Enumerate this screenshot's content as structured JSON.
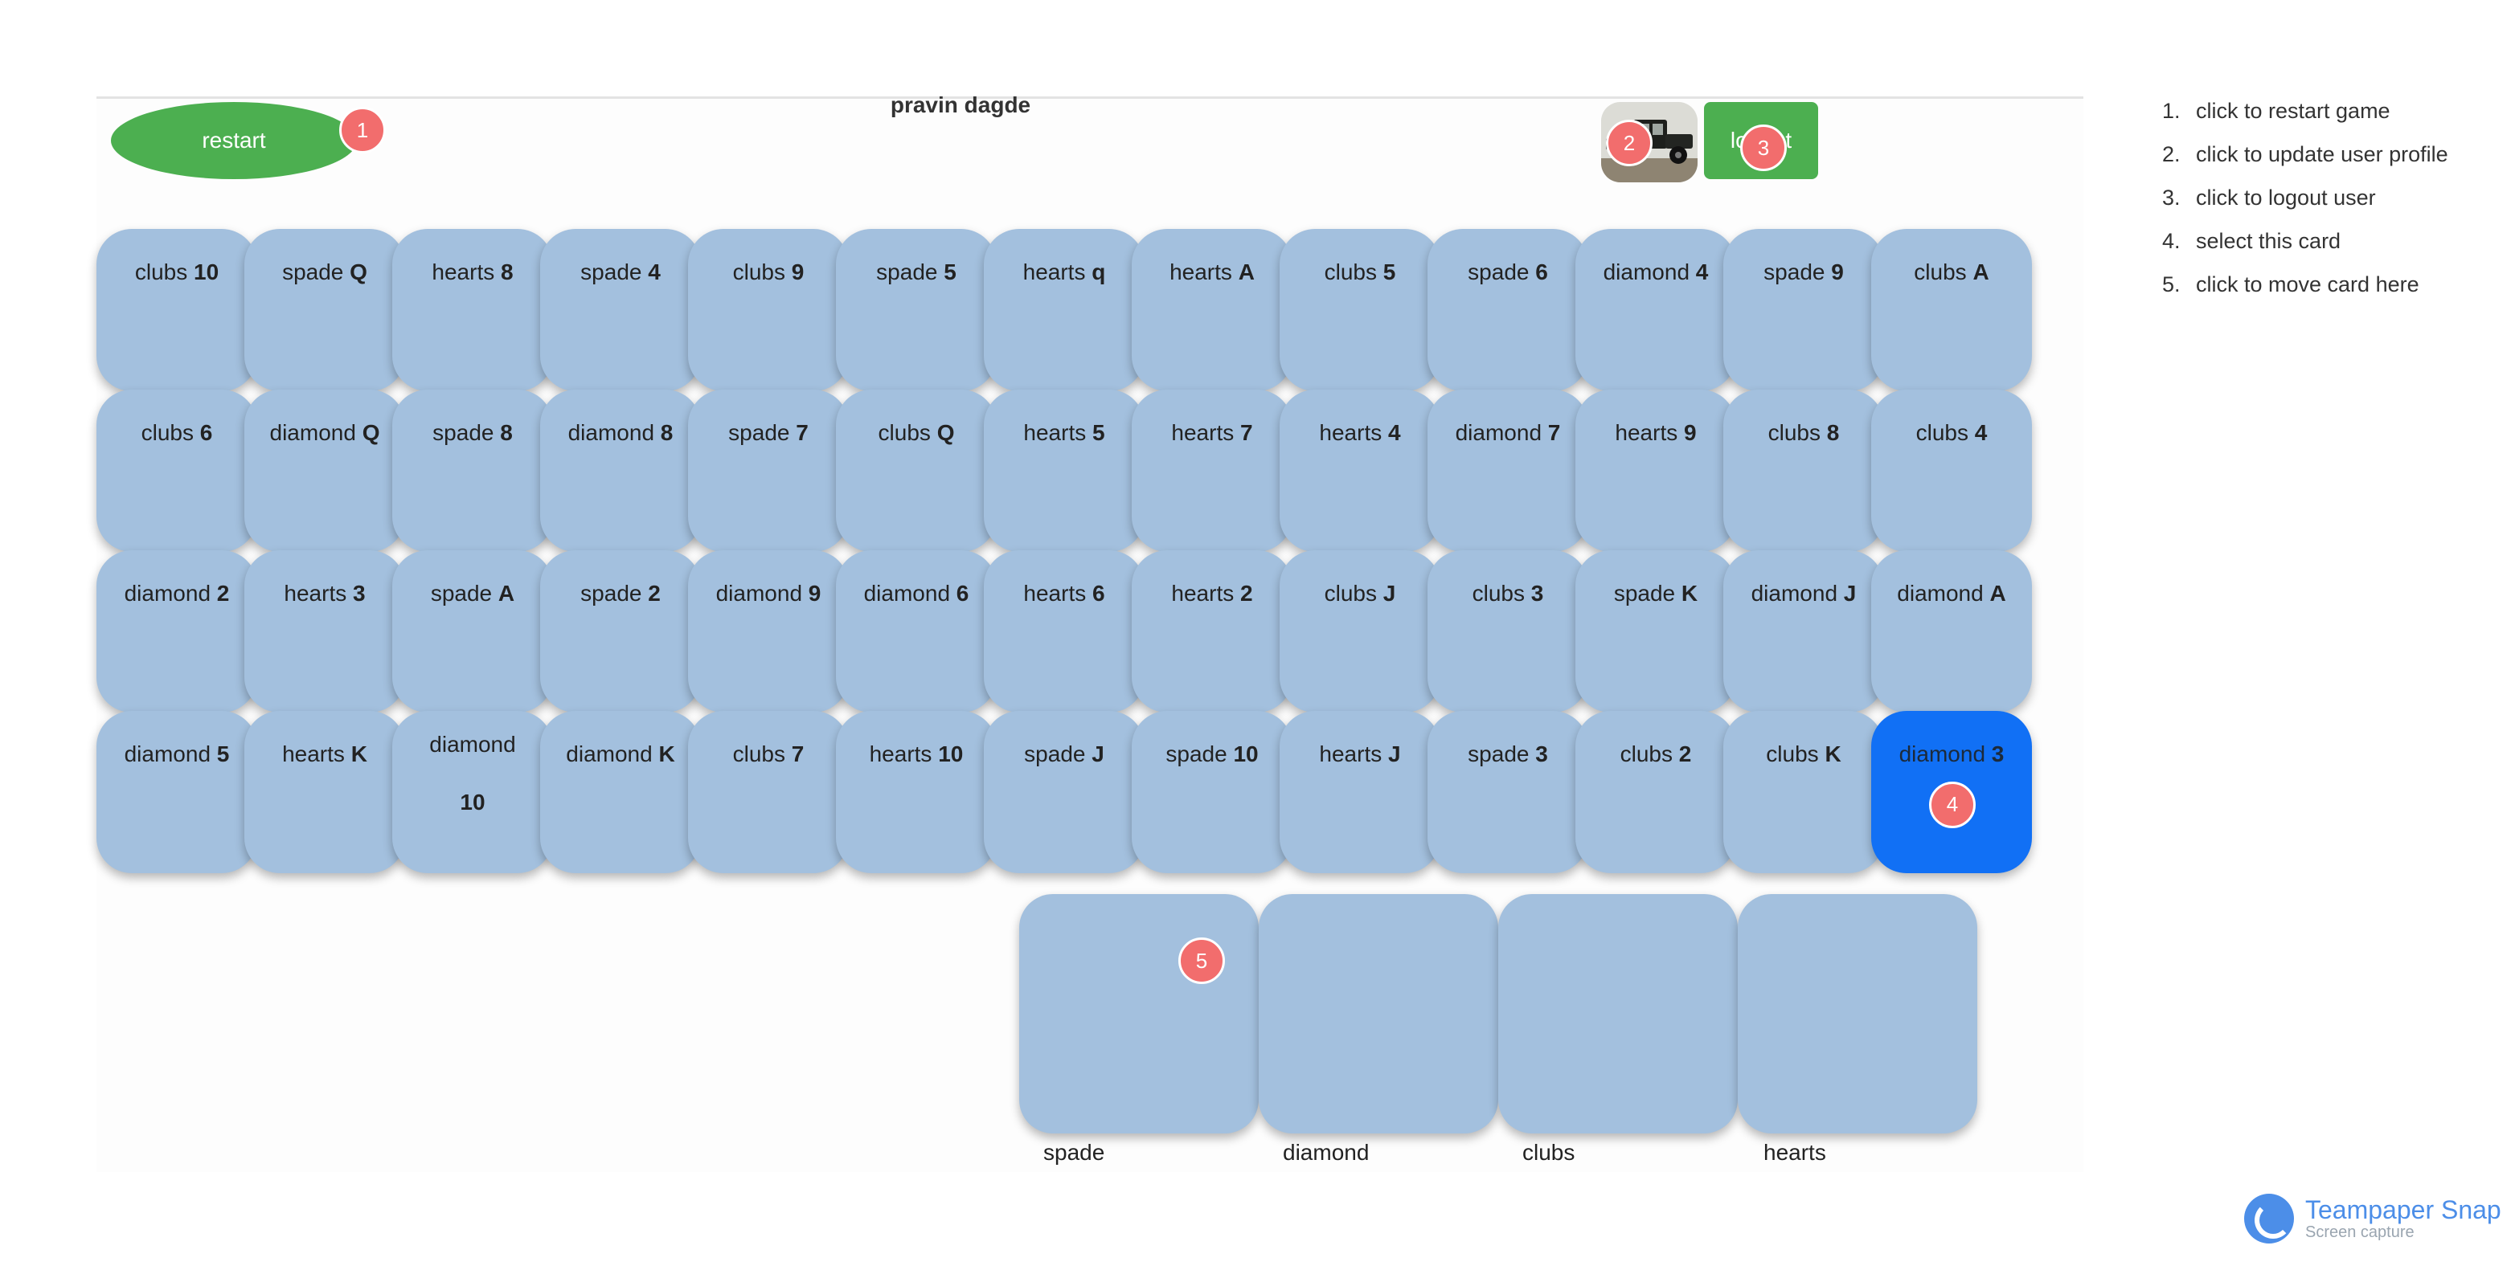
{
  "header": {
    "restart_label": "restart",
    "username": "pravin dagde",
    "logout_label": "logout"
  },
  "badges": [
    "1",
    "2",
    "3",
    "4",
    "5"
  ],
  "board": {
    "rows": [
      [
        {
          "suit": "clubs",
          "rank": "10"
        },
        {
          "suit": "spade",
          "rank": "Q"
        },
        {
          "suit": "hearts",
          "rank": "8"
        },
        {
          "suit": "spade",
          "rank": "4"
        },
        {
          "suit": "clubs",
          "rank": "9"
        },
        {
          "suit": "spade",
          "rank": "5"
        },
        {
          "suit": "hearts",
          "rank": "q"
        },
        {
          "suit": "hearts",
          "rank": "A"
        },
        {
          "suit": "clubs",
          "rank": "5"
        },
        {
          "suit": "spade",
          "rank": "6"
        },
        {
          "suit": "diamond",
          "rank": "4"
        },
        {
          "suit": "spade",
          "rank": "9"
        },
        {
          "suit": "clubs",
          "rank": "A"
        }
      ],
      [
        {
          "suit": "clubs",
          "rank": "6"
        },
        {
          "suit": "diamond",
          "rank": "Q"
        },
        {
          "suit": "spade",
          "rank": "8"
        },
        {
          "suit": "diamond",
          "rank": "8"
        },
        {
          "suit": "spade",
          "rank": "7"
        },
        {
          "suit": "clubs",
          "rank": "Q"
        },
        {
          "suit": "hearts",
          "rank": "5"
        },
        {
          "suit": "hearts",
          "rank": "7"
        },
        {
          "suit": "hearts",
          "rank": "4"
        },
        {
          "suit": "diamond",
          "rank": "7"
        },
        {
          "suit": "hearts",
          "rank": "9"
        },
        {
          "suit": "clubs",
          "rank": "8"
        },
        {
          "suit": "clubs",
          "rank": "4"
        }
      ],
      [
        {
          "suit": "diamond",
          "rank": "2"
        },
        {
          "suit": "hearts",
          "rank": "3"
        },
        {
          "suit": "spade",
          "rank": "A"
        },
        {
          "suit": "spade",
          "rank": "2"
        },
        {
          "suit": "diamond",
          "rank": "9"
        },
        {
          "suit": "diamond",
          "rank": "6"
        },
        {
          "suit": "hearts",
          "rank": "6"
        },
        {
          "suit": "hearts",
          "rank": "2"
        },
        {
          "suit": "clubs",
          "rank": "J"
        },
        {
          "suit": "clubs",
          "rank": "3"
        },
        {
          "suit": "spade",
          "rank": "K"
        },
        {
          "suit": "diamond",
          "rank": "J"
        },
        {
          "suit": "diamond",
          "rank": "A"
        }
      ],
      [
        {
          "suit": "diamond",
          "rank": "5"
        },
        {
          "suit": "hearts",
          "rank": "K"
        },
        {
          "suit": "diamond",
          "rank": "10",
          "wrap": true
        },
        {
          "suit": "diamond",
          "rank": "K"
        },
        {
          "suit": "clubs",
          "rank": "7"
        },
        {
          "suit": "hearts",
          "rank": "10"
        },
        {
          "suit": "spade",
          "rank": "J"
        },
        {
          "suit": "spade",
          "rank": "10"
        },
        {
          "suit": "hearts",
          "rank": "J"
        },
        {
          "suit": "spade",
          "rank": "3"
        },
        {
          "suit": "clubs",
          "rank": "2"
        },
        {
          "suit": "clubs",
          "rank": "K"
        },
        {
          "suit": "diamond",
          "rank": "3",
          "selected": true
        }
      ]
    ]
  },
  "foundations": [
    "spade",
    "diamond",
    "clubs",
    "hearts"
  ],
  "help": [
    {
      "num": "1.",
      "text": "click to restart game"
    },
    {
      "num": "2.",
      "text": "click to update user profile"
    },
    {
      "num": "3.",
      "text": "click to logout user"
    },
    {
      "num": "4.",
      "text": "select this card"
    },
    {
      "num": "5.",
      "text": "click to move card here"
    }
  ],
  "brand": {
    "name": "Teampaper Snap",
    "subtitle": "Screen capture"
  },
  "colors": {
    "card": "#a3c0de",
    "selected": "#1170f5",
    "button": "#4caf50",
    "badge": "#f26d6d",
    "brand": "#4c8ee8"
  }
}
